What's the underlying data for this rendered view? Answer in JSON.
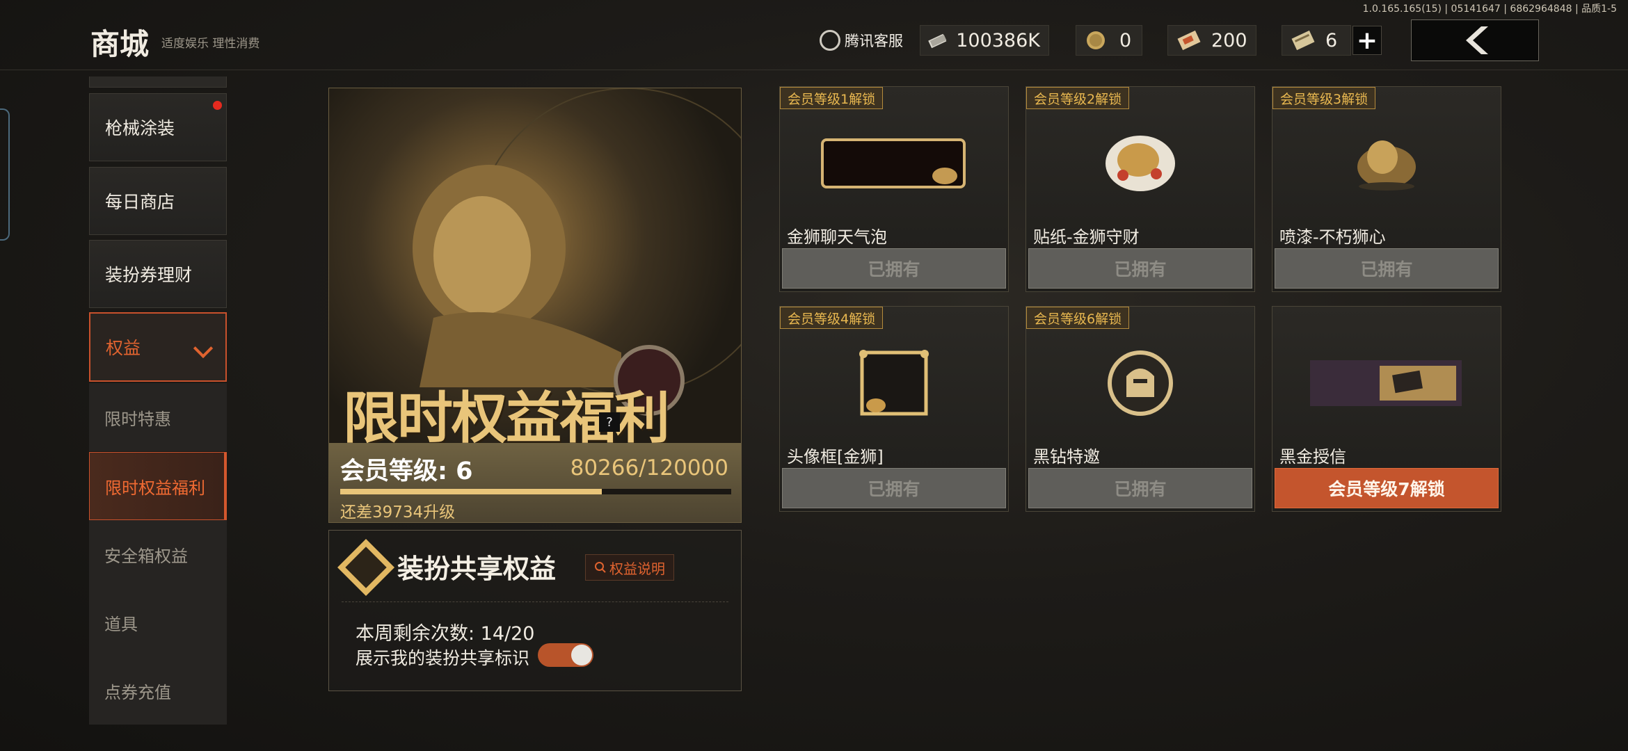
{
  "build_info": "1.0.165.165(15) | 05141647 | 6862964848 | 品质1-5",
  "header": {
    "title": "商城",
    "subtitle": "适度娱乐 理性消费",
    "customer_service": "腾讯客服",
    "currencies": [
      {
        "icon": "cash-stack-icon",
        "value": "100386K"
      },
      {
        "icon": "coin-icon",
        "value": "0"
      },
      {
        "icon": "ticket-icon",
        "value": "200"
      },
      {
        "icon": "voucher-icon",
        "value": "6"
      }
    ],
    "plus_label": "+"
  },
  "sidebar": {
    "items": [
      {
        "label": "枪械涂装"
      },
      {
        "label": "每日商店"
      },
      {
        "label": "装扮券理财"
      },
      {
        "label": "权益"
      },
      {
        "label": "限时特惠"
      },
      {
        "label": "限时权益福利"
      },
      {
        "label": "安全箱权益"
      },
      {
        "label": "道具"
      },
      {
        "label": "点券充值"
      }
    ]
  },
  "banner": {
    "title": "限时权益福利",
    "help": "?",
    "level_label": "会员等级: 6",
    "progress_text": "80266/120000",
    "progress_fraction": 0.669,
    "need_text": "还差39734升级"
  },
  "share": {
    "title": "装扮共享权益",
    "explain_label": "权益说明",
    "remaining": "本周剩余次数: 14/20",
    "show_mark": "展示我的装扮共享标识",
    "toggle_on": true
  },
  "rewards": [
    {
      "badge": "会员等级1解锁",
      "name": "金狮聊天气泡",
      "status": "已拥有",
      "thumb": "chat-bubble-icon"
    },
    {
      "badge": "会员等级2解锁",
      "name": "贴纸-金狮守财",
      "status": "已拥有",
      "thumb": "sticker-icon"
    },
    {
      "badge": "会员等级3解锁",
      "name": "喷漆-不朽狮心",
      "status": "已拥有",
      "thumb": "spray-icon"
    },
    {
      "badge": "会员等级4解锁",
      "name": "头像框[金狮]",
      "status": "已拥有",
      "thumb": "avatar-frame-icon"
    },
    {
      "badge": "会员等级6解锁",
      "name": "黑钻特邀",
      "status": "已拥有",
      "thumb": "helmet-emblem-icon"
    },
    {
      "badge": "",
      "name": "黑金授信",
      "status": "会员等级7解锁",
      "thumb": "black-gold-card-icon"
    }
  ]
}
